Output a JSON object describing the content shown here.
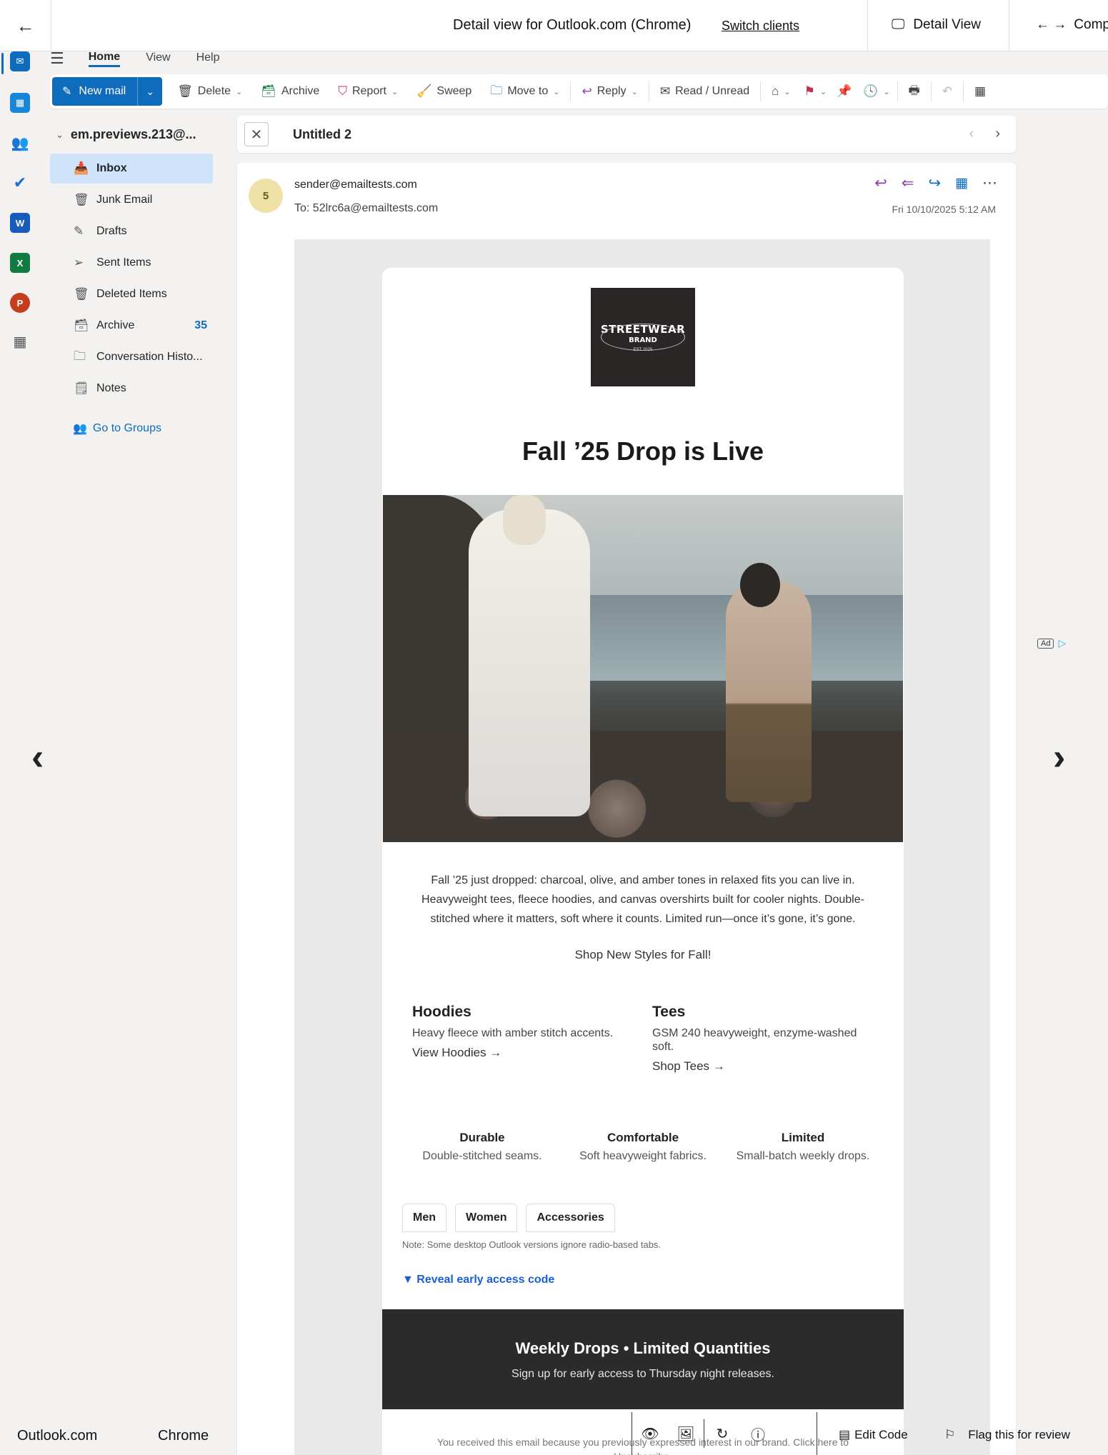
{
  "topbar": {
    "title": "Detail view for Outlook.com (Chrome)",
    "switch_clients": "Switch clients",
    "detail_view": "Detail View",
    "compare": "Comp"
  },
  "nav_tabs": [
    "Home",
    "View",
    "Help"
  ],
  "toolbar": {
    "new_mail": "New mail",
    "delete": "Delete",
    "archive": "Archive",
    "report": "Report",
    "sweep": "Sweep",
    "move_to": "Move to",
    "reply": "Reply",
    "read_unread": "Read / Unread"
  },
  "account": "em.previews.213@...",
  "folders": [
    {
      "label": "Inbox",
      "icon": "inbox-icon",
      "count": ""
    },
    {
      "label": "Junk Email",
      "icon": "junk-icon",
      "count": ""
    },
    {
      "label": "Drafts",
      "icon": "drafts-icon",
      "count": ""
    },
    {
      "label": "Sent Items",
      "icon": "send-icon",
      "count": ""
    },
    {
      "label": "Deleted Items",
      "icon": "trash-icon",
      "count": ""
    },
    {
      "label": "Archive",
      "icon": "archive-icon",
      "count": "35"
    },
    {
      "label": "Conversation Histo...",
      "icon": "folder-icon",
      "count": ""
    },
    {
      "label": "Notes",
      "icon": "note-icon",
      "count": ""
    }
  ],
  "go_to_groups": "Go to Groups",
  "subject": "Untitled 2",
  "message": {
    "avatar_initial": "5",
    "sender": "sender@emailtests.com",
    "to": "To:  52lrc6a@emailtests.com",
    "date": "Fri 10/10/2025 5:12 AM"
  },
  "email": {
    "logo_line1": "STREETWEAR",
    "logo_line2": "BRAND",
    "logo_line3": "EST 2025",
    "headline": "Fall ’25 Drop is Live",
    "body": "Fall ’25 just dropped: charcoal, olive, and amber tones in relaxed fits you can live in. Heavyweight tees, fleece hoodies, and canvas overshirts built for cooler nights. Double-stitched where it matters, soft where it counts. Limited run—once it’s gone, it’s gone.",
    "shop": "Shop New Styles for Fall!",
    "col1_title": "Hoodies",
    "col1_text": "Heavy fleece with amber stitch accents.",
    "col1_link": "View Hoodies →",
    "col2_title": "Tees",
    "col2_text": "GSM 240 heavyweight, enzyme-washed soft.",
    "col2_link": "Shop Tees →",
    "feat1_title": "Durable",
    "feat1_text": "Double-stitched seams.",
    "feat2_title": "Comfortable",
    "feat2_text": "Soft heavyweight fabrics.",
    "feat3_title": "Limited",
    "feat3_text": "Small-batch weekly drops.",
    "tab1": "Men",
    "tab2": "Women",
    "tab3": "Accessories",
    "note": "Note: Some desktop Outlook versions ignore radio-based tabs.",
    "reveal": "▼ Reveal early access code",
    "banner_title": "Weekly Drops • Limited Quantities",
    "banner_text": "Sign up for early access to Thursday night releases.",
    "footer": "You received this email because you previously expressed interest in our brand. Click here to Unsubscribe."
  },
  "ad_badge": "Ad",
  "bottom": {
    "client": "Outlook.com",
    "browser": "Chrome",
    "edit_code": "Edit Code",
    "flag": "Flag this for review"
  },
  "colors": {
    "accent": "#0f6cbd",
    "selected_folder": "#cfe4fa",
    "banner": "#2b2b2b"
  }
}
